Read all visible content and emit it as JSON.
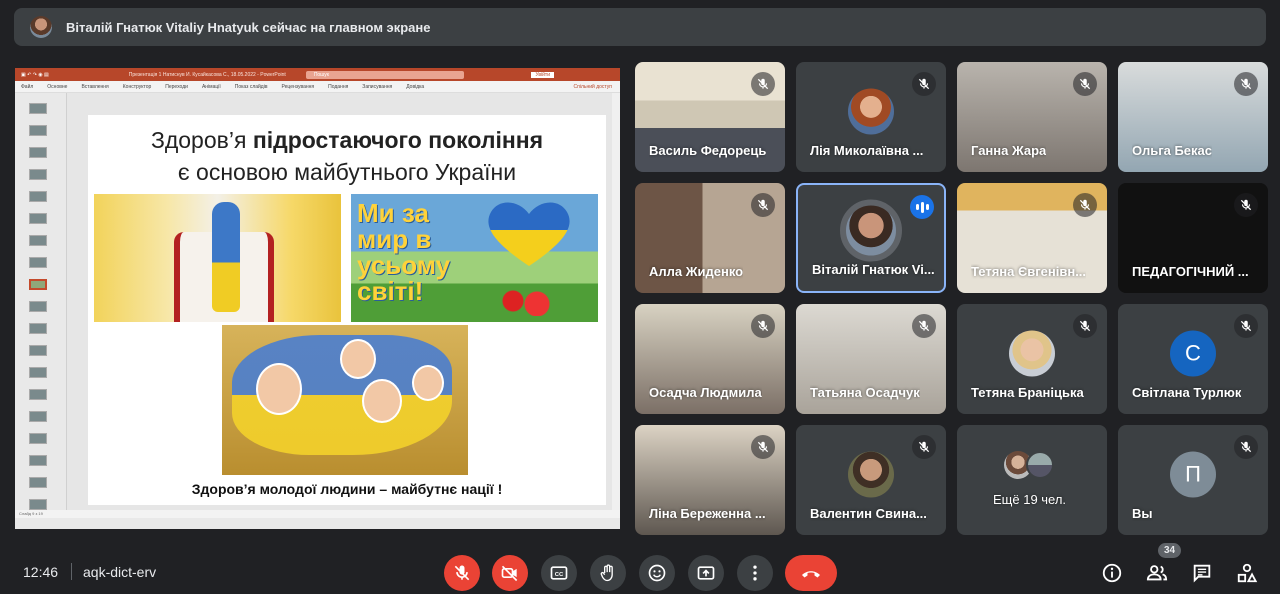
{
  "banner": {
    "text": "Віталій Гнатюк Vitaliy Hnatyuk сейчас на главном экране"
  },
  "presentation": {
    "window_title": "Презентація 1 Натиснув И. Кусайкасова С., 18.05.2022 - PowerPoint",
    "search_placeholder": "Пошук",
    "login_label": "Увійти",
    "menu_items": [
      "Файл",
      "Основне",
      "Вставлення",
      "Конструктор",
      "Переходи",
      "Анімації",
      "Показ слайдів",
      "Рецензування",
      "Подання",
      "Записування",
      "Довідка"
    ],
    "share_label": "Спільний доступ",
    "status_text": "Слайд 9 з 19",
    "slide": {
      "title_normal": "Здоров’я ",
      "title_bold": "підростаючого покоління",
      "subtitle": "є основою майбутнього України",
      "slogan": "Ми за мир в усьому світі!",
      "caption": "Здоров’я молодої людини – майбутнє нації !"
    }
  },
  "participants": [
    {
      "name": "Василь Федорець"
    },
    {
      "name": "Лія Миколаївна ..."
    },
    {
      "name": "Ганна Жара"
    },
    {
      "name": "Ольга Бекас"
    },
    {
      "name": "Алла Жиденко"
    },
    {
      "name": "Віталій Гнатюк Vi..."
    },
    {
      "name": "Тетяна Євгенівн..."
    },
    {
      "name": "ПЕДАГОГІЧНИЙ ..."
    },
    {
      "name": "Осадча Людмила"
    },
    {
      "name": "Татьяна Осадчук"
    },
    {
      "name": "Тетяна Браніцька"
    },
    {
      "name": "Світлана Турлюк",
      "initial": "С",
      "color": "#1565c0"
    },
    {
      "name": "Ліна Береженна ..."
    },
    {
      "name": "Валентин Свина..."
    },
    {
      "name": "Ещё 19 чел."
    },
    {
      "name": "Вы",
      "initial": "П",
      "color": "#7e8c97"
    }
  ],
  "controls": {
    "time": "12:46",
    "meeting_code": "aqk-dict-erv",
    "participants_count": "34"
  },
  "colors": {
    "background": "#202124",
    "tile": "#3c4043",
    "danger": "#ea4335",
    "accent": "#8ab4f8"
  }
}
